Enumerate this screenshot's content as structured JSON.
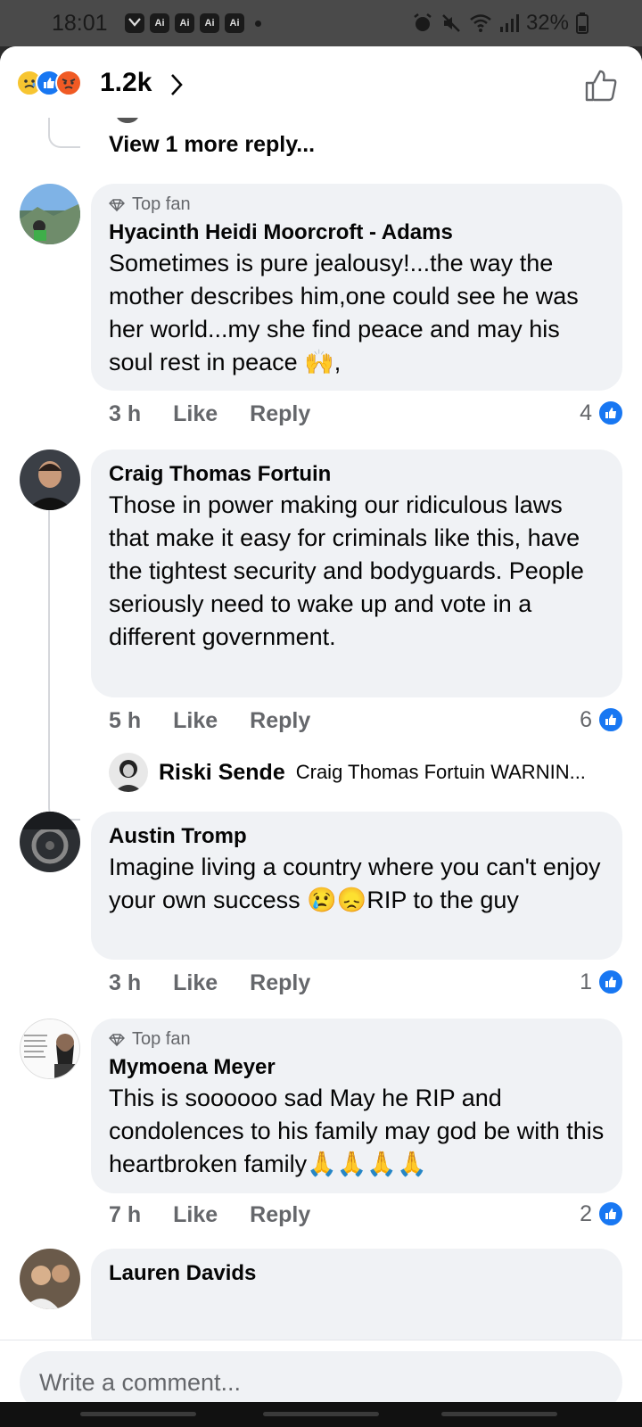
{
  "status_bar": {
    "time": "18:01",
    "app_badges": [
      "Ai",
      "Ai",
      "Ai",
      "Ai"
    ],
    "battery": "32%"
  },
  "header": {
    "reaction_count": "1.2k"
  },
  "view_more": "View 1 more reply...",
  "comments": [
    {
      "badge": "Top fan",
      "author": "Hyacinth Heidi Moorcroft - Adams",
      "text": "Sometimes is pure jealousy!...the way the mother describes him,one could see he was her world...my she find peace and may his soul rest in peace 🙌,",
      "time": "3 h",
      "like_label": "Like",
      "reply_label": "Reply",
      "likes": "4"
    },
    {
      "author": "Craig Thomas Fortuin",
      "text": "Those in power making our ridiculous laws that make it easy for criminals like this, have the tightest security and bodyguards. People seriously need to wake up and vote in a different government.",
      "time": "5 h",
      "like_label": "Like",
      "reply_label": "Reply",
      "likes": "6",
      "reply_preview": {
        "name": "Riski Sende",
        "snippet": "Craig Thomas Fortuin WARNIN..."
      }
    },
    {
      "author": "Austin Tromp",
      "text": "Imagine living a country where you can't enjoy your own success 😢😞RIP to the guy",
      "time": "3 h",
      "like_label": "Like",
      "reply_label": "Reply",
      "likes": "1"
    },
    {
      "badge": "Top fan",
      "author": "Mymoena Meyer",
      "text": "This is soooooo sad May he RIP and condolences to his family may god be with this heartbroken family🙏🙏🙏🙏",
      "time": "7 h",
      "like_label": "Like",
      "reply_label": "Reply",
      "likes": "2"
    },
    {
      "author": "Lauren Davids"
    }
  ],
  "composer": {
    "placeholder": "Write a comment..."
  },
  "colors": {
    "accent": "#1877f2",
    "bubble": "#f0f2f5",
    "meta_text": "#65676b"
  }
}
